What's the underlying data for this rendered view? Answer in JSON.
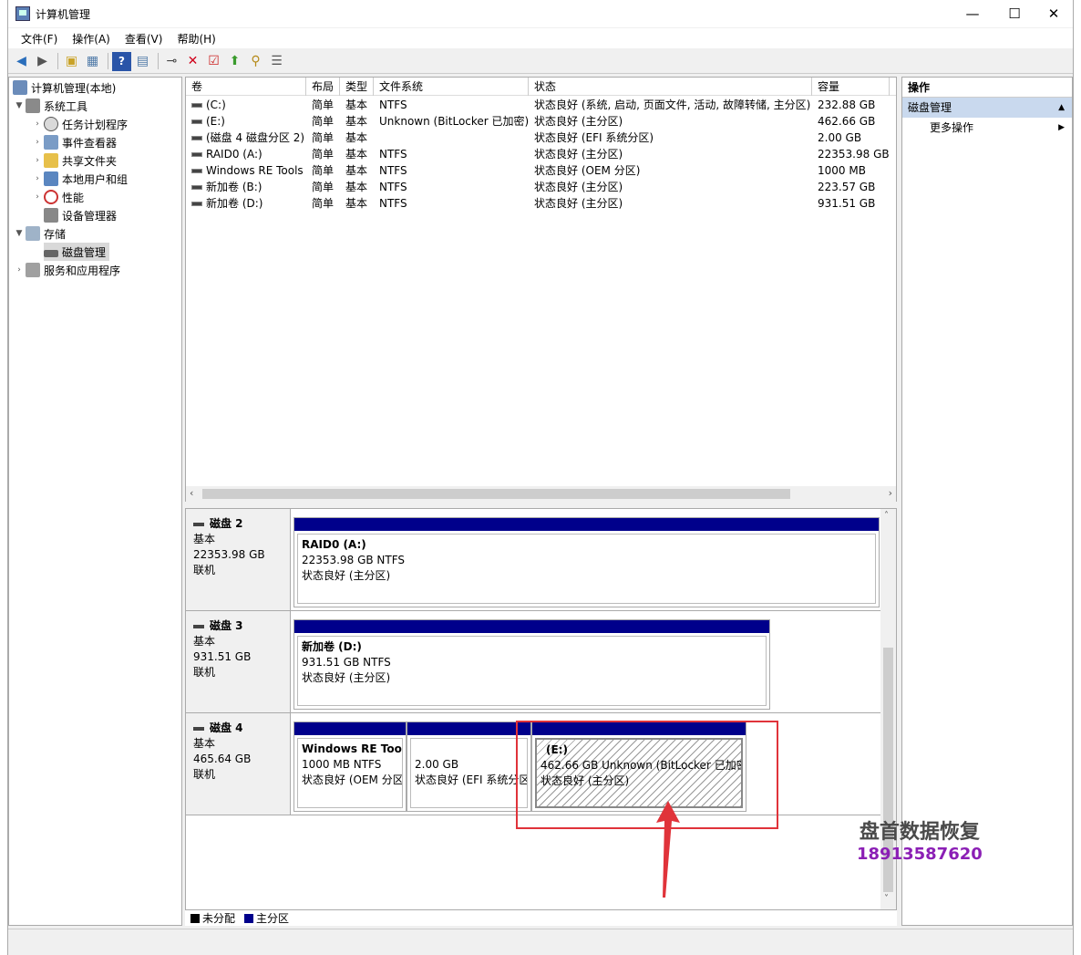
{
  "window": {
    "title": "计算机管理",
    "minimize": "—",
    "maximize": "☐",
    "close": "✕"
  },
  "menu": [
    "文件(F)",
    "操作(A)",
    "查看(V)",
    "帮助(H)"
  ],
  "toolbar_icons": [
    "back-icon",
    "forward-icon",
    "up-folder-icon",
    "show-hide-tree-icon",
    "help-icon",
    "properties-icon",
    "connect-icon",
    "delete-icon",
    "check-icon",
    "export-icon",
    "search-icon",
    "list-icon"
  ],
  "tree": {
    "root": "计算机管理(本地)",
    "system_tools": "系统工具",
    "task_scheduler": "任务计划程序",
    "event_viewer": "事件查看器",
    "shared_folders": "共享文件夹",
    "local_users": "本地用户和组",
    "performance": "性能",
    "device_manager": "设备管理器",
    "storage": "存储",
    "disk_management": "磁盘管理",
    "services": "服务和应用程序"
  },
  "table": {
    "headers": [
      "卷",
      "布局",
      "类型",
      "文件系统",
      "状态",
      "容量"
    ],
    "rows": [
      {
        "vol": "(C:)",
        "layout": "简单",
        "type": "基本",
        "fs": "NTFS",
        "status": "状态良好 (系统, 启动, 页面文件, 活动, 故障转储, 主分区)",
        "cap": "232.88 GB"
      },
      {
        "vol": "(E:)",
        "layout": "简单",
        "type": "基本",
        "fs": "Unknown (BitLocker 已加密)",
        "status": "状态良好 (主分区)",
        "cap": "462.66 GB"
      },
      {
        "vol": "(磁盘 4 磁盘分区 2)",
        "layout": "简单",
        "type": "基本",
        "fs": "",
        "status": "状态良好 (EFI 系统分区)",
        "cap": "2.00 GB"
      },
      {
        "vol": "RAID0 (A:)",
        "layout": "简单",
        "type": "基本",
        "fs": "NTFS",
        "status": "状态良好 (主分区)",
        "cap": "22353.98 GB"
      },
      {
        "vol": "Windows RE Tools",
        "layout": "简单",
        "type": "基本",
        "fs": "NTFS",
        "status": "状态良好 (OEM 分区)",
        "cap": "1000 MB"
      },
      {
        "vol": "新加卷 (B:)",
        "layout": "简单",
        "type": "基本",
        "fs": "NTFS",
        "status": "状态良好 (主分区)",
        "cap": "223.57 GB"
      },
      {
        "vol": "新加卷 (D:)",
        "layout": "简单",
        "type": "基本",
        "fs": "NTFS",
        "status": "状态良好 (主分区)",
        "cap": "931.51 GB"
      }
    ]
  },
  "disks": [
    {
      "name": "磁盘 2",
      "type": "基本",
      "size": "22353.98 GB",
      "state": "联机",
      "parts": [
        {
          "title": "RAID0  (A:)",
          "line2": "22353.98 GB NTFS",
          "line3": "状态良好 (主分区)"
        }
      ]
    },
    {
      "name": "磁盘 3",
      "type": "基本",
      "size": "931.51 GB",
      "state": "联机",
      "parts": [
        {
          "title": "新加卷  (D:)",
          "line2": "931.51 GB NTFS",
          "line3": "状态良好 (主分区)"
        }
      ]
    },
    {
      "name": "磁盘 4",
      "type": "基本",
      "size": "465.64 GB",
      "state": "联机",
      "parts": [
        {
          "title": "Windows RE Tool",
          "line2": "1000 MB NTFS",
          "line3": "状态良好 (OEM 分区"
        },
        {
          "title": "",
          "line2": "2.00 GB",
          "line3": "状态良好 (EFI 系统分区"
        },
        {
          "title": "(E:)",
          "line2": "462.66 GB Unknown (BitLocker 已加密",
          "line3": "状态良好 (主分区)"
        }
      ]
    }
  ],
  "legend": {
    "unallocated": "未分配",
    "primary": "主分区",
    "unallocated_color": "#000000",
    "primary_color": "#00008b"
  },
  "actions": {
    "header": "操作",
    "section": "磁盘管理",
    "more": "更多操作"
  },
  "watermark": {
    "line1": "盘首数据恢复",
    "line2": "18913587620"
  },
  "colors": {
    "partition_bar": "#00008b",
    "highlight": "#e0333a",
    "arrow": "#e0333a"
  }
}
